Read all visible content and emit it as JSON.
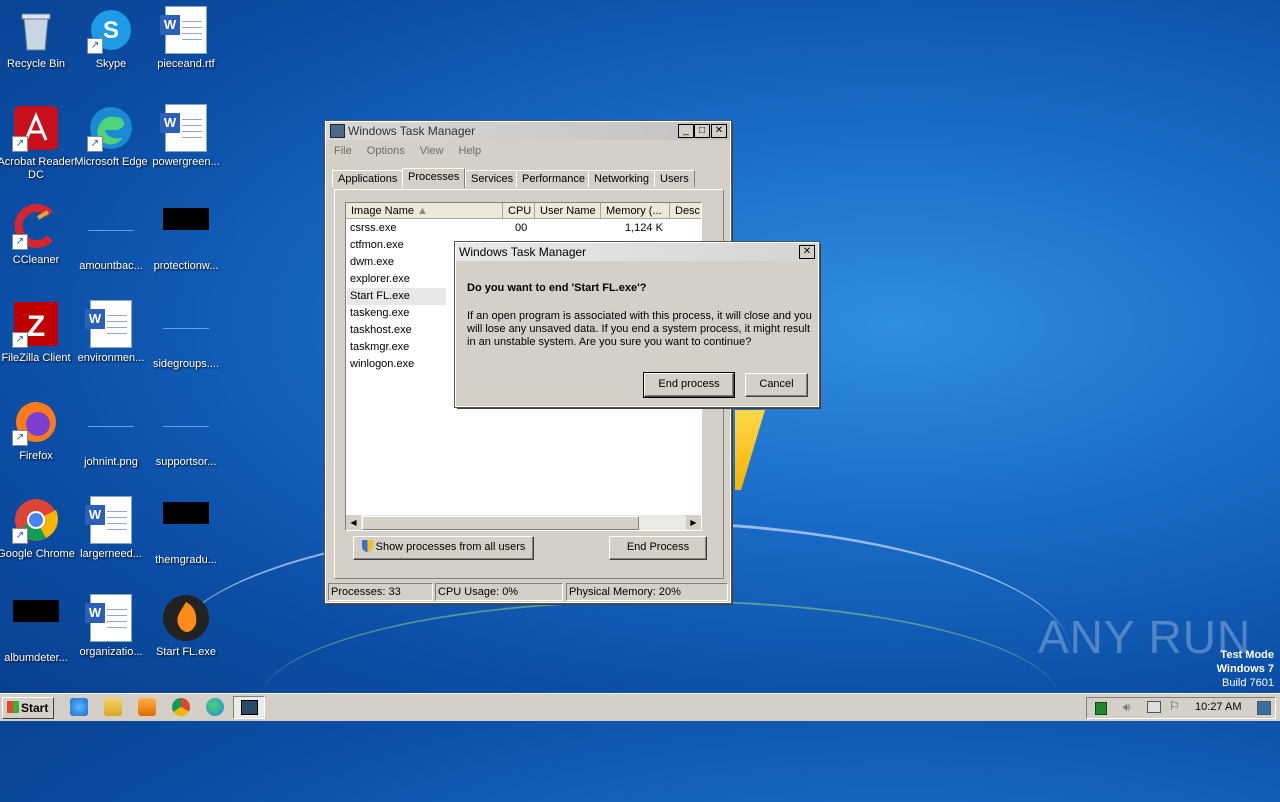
{
  "desktop": {
    "icons": [
      {
        "label": "Recycle Bin"
      },
      {
        "label": "Skype"
      },
      {
        "label": "pieceand.rtf"
      },
      {
        "label": "Acrobat Reader DC"
      },
      {
        "label": "Microsoft Edge"
      },
      {
        "label": "powergreen..."
      },
      {
        "label": "CCleaner"
      },
      {
        "label": "amountbac..."
      },
      {
        "label": "protectionw..."
      },
      {
        "label": "FileZilla Client"
      },
      {
        "label": "environmen..."
      },
      {
        "label": "sidegroups...."
      },
      {
        "label": "Firefox"
      },
      {
        "label": "johnint.png"
      },
      {
        "label": "supportsor..."
      },
      {
        "label": "Google Chrome"
      },
      {
        "label": "largerneed..."
      },
      {
        "label": "themgradu..."
      },
      {
        "label": "albumdeter..."
      },
      {
        "label": "organizatio..."
      },
      {
        "label": "Start FL.exe"
      }
    ]
  },
  "taskmgr": {
    "title": "Windows Task Manager",
    "menu": [
      "File",
      "Options",
      "View",
      "Help"
    ],
    "tabs": [
      "Applications",
      "Processes",
      "Services",
      "Performance",
      "Networking",
      "Users"
    ],
    "columns": [
      "Image Name",
      "CPU",
      "User Name",
      "Memory (...",
      "Desc"
    ],
    "processes": [
      {
        "name": "csrss.exe",
        "cpu": "00",
        "mem": "1,124 K"
      },
      {
        "name": "ctfmon.exe"
      },
      {
        "name": "dwm.exe"
      },
      {
        "name": "explorer.exe"
      },
      {
        "name": "Start FL.exe"
      },
      {
        "name": "taskeng.exe"
      },
      {
        "name": "taskhost.exe"
      },
      {
        "name": "taskmgr.exe"
      },
      {
        "name": "winlogon.exe"
      }
    ],
    "show_all_label": "Show processes from all users",
    "end_process_label": "End Process",
    "status": {
      "processes": "Processes: 33",
      "cpu": "CPU Usage: 0%",
      "memory": "Physical Memory: 20%"
    }
  },
  "dialog": {
    "title": "Windows Task Manager",
    "question": "Do you want to end 'Start FL.exe'?",
    "message": "If an open program is associated with this process, it will close and you will lose any unsaved data. If you end a system process, it might result in an unstable system. Are you sure you want to continue?",
    "end_label": "End process",
    "cancel_label": "Cancel"
  },
  "taskbar": {
    "start_label": "Start",
    "clock": "10:27 AM"
  },
  "watermark": {
    "brand": "ANY RUN",
    "line1": "Test Mode",
    "line2": "Windows 7",
    "line3": "Build 7601"
  },
  "colors": {
    "desktop": "#1a6cc7",
    "window_face": "#d4d0c8"
  }
}
